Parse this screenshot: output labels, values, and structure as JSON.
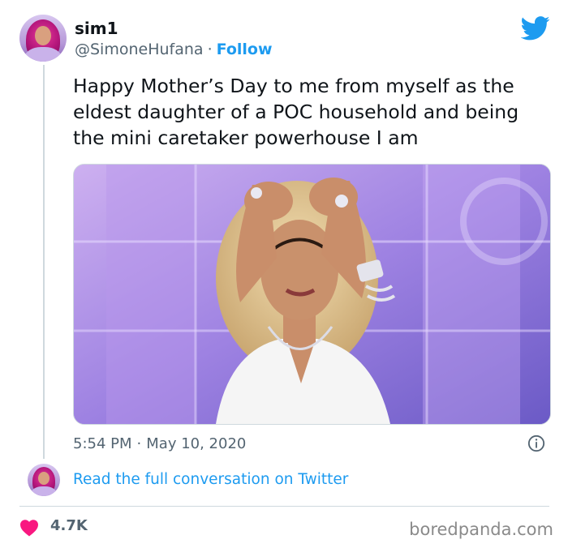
{
  "author": {
    "name": "sim1",
    "handle": "@SimoneHufana",
    "separator": "·",
    "follow_label": "Follow"
  },
  "tweet": {
    "text": "Happy Mother’s Day to me from myself as the eldest daughter of a POC household and being the mini caretaker powerhouse I am",
    "time": "5:54 PM",
    "separator": "·",
    "date": "May 10, 2020"
  },
  "reply": {
    "link_text": "Read the full conversation on Twitter"
  },
  "stats": {
    "likes": "4.7K"
  },
  "watermark": "boredpanda.com",
  "colors": {
    "link_blue": "#1d9bf0",
    "heart_red": "#f91880",
    "text_primary": "#0f1419",
    "text_secondary": "#536471"
  },
  "icons": {
    "brand": "twitter-bird-icon",
    "info": "info-icon",
    "like": "heart-icon"
  }
}
